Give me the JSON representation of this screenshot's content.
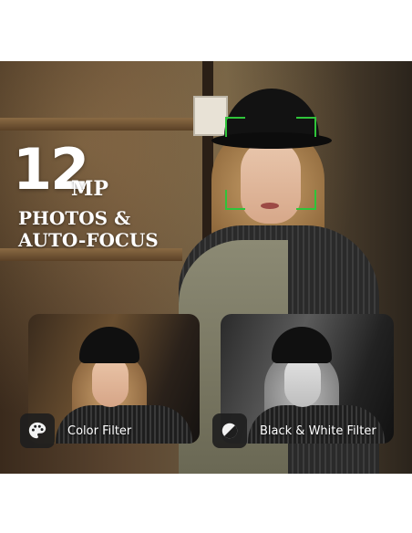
{
  "headline": {
    "number": "12",
    "unit": "MP",
    "line1": "PHOTOS &",
    "line2": "AUTO-FOCUS"
  },
  "filters": [
    {
      "label": "Color Filter",
      "icon": "palette-icon"
    },
    {
      "label": "Black & White Filter",
      "icon": "contrast-icon"
    }
  ],
  "colors": {
    "focus_bracket": "#2fc43a",
    "text": "#ffffff",
    "icon_tile": "#1e1e1e"
  }
}
